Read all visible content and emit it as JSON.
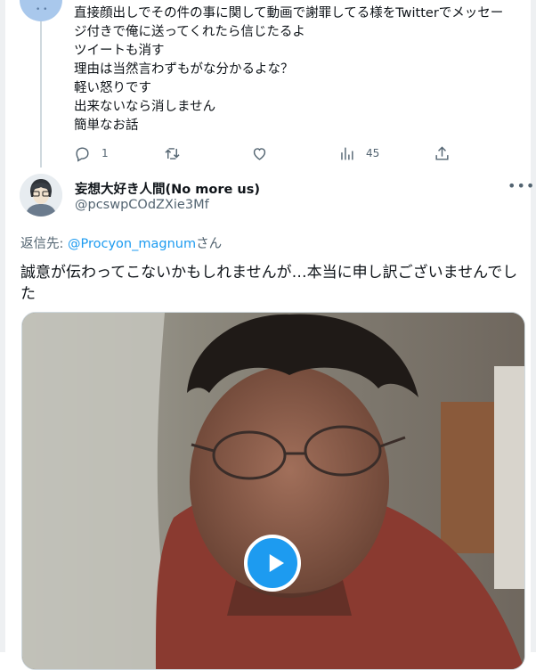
{
  "tweet1": {
    "lines": [
      "直接顔出しでその件の事に関して動画で謝罪してる様をTwitterでメッセー",
      "ジ付きで俺に送ってくれたら信じたるよ",
      "ツイートも消す",
      "理由は当然言わずもがな分かるよな？",
      "軽い怒りです",
      "出来ないなら消しません",
      "簡単なお話"
    ],
    "actions": {
      "reply_count": "1",
      "retweet_count": "",
      "like_count": "",
      "views_count": "45"
    }
  },
  "tweet2": {
    "display_name": "妄想大好き人間(No more us)",
    "handle": "@pcswpCOdZXie3Mf",
    "reply_prefix": "返信先: ",
    "reply_mention": "@Procyon_magnum",
    "reply_suffix": "さん",
    "text": "誠意が伝わってこないかもしれませんが…本当に申し訳ございませんでした",
    "more_label": "•••"
  },
  "colors": {
    "accent": "#1d9bf0",
    "secondary_text": "#536471",
    "primary_text": "#0f1419"
  }
}
